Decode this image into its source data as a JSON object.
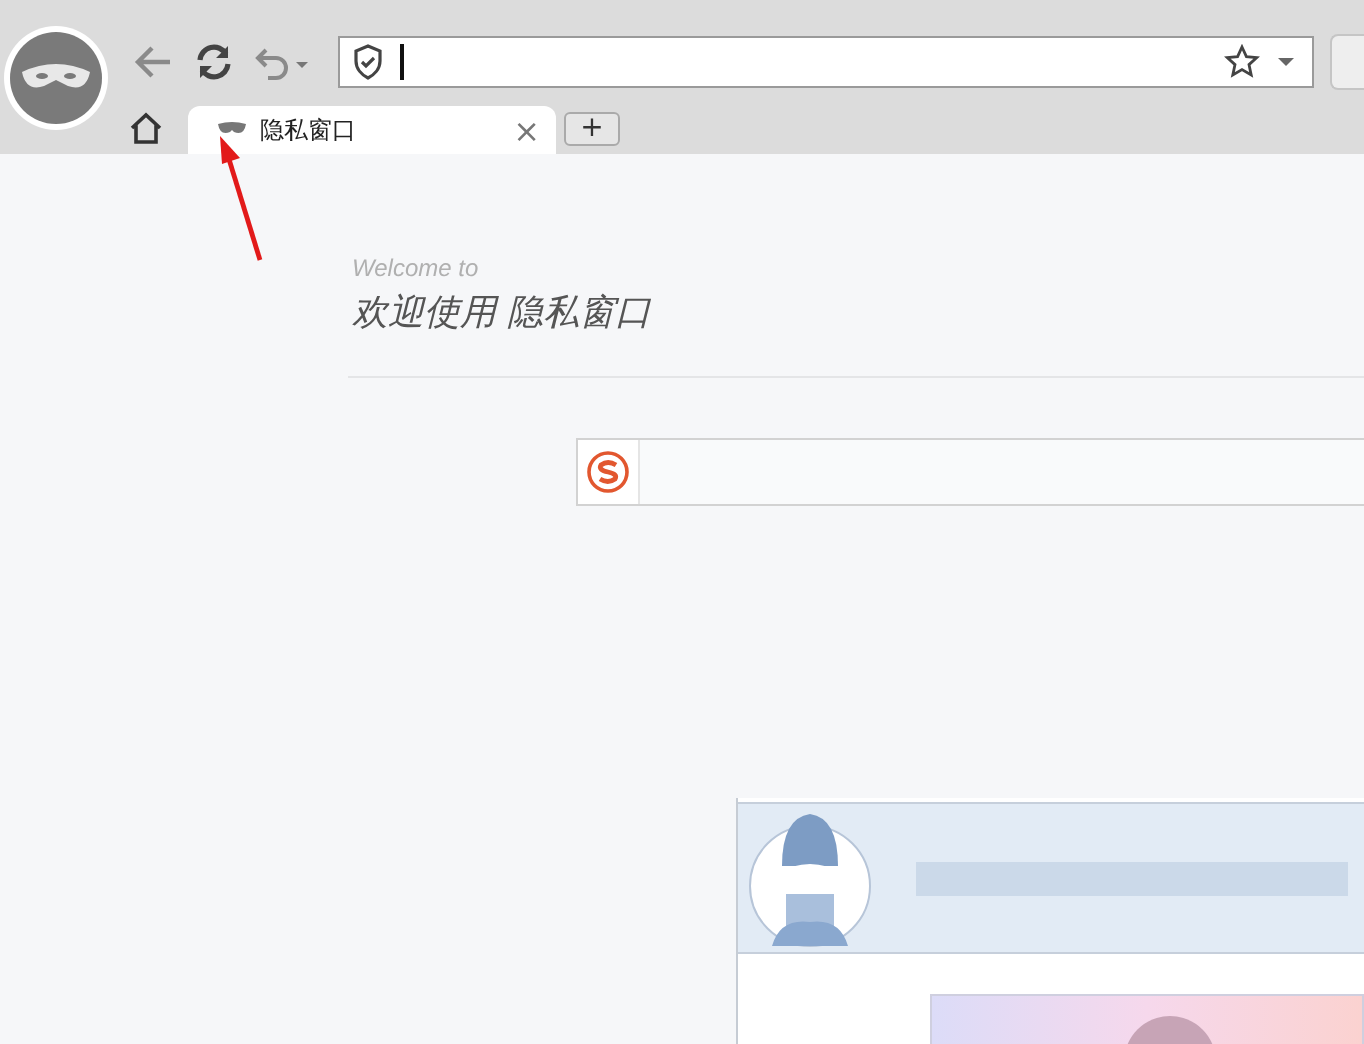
{
  "tabs": [
    {
      "label": "隐私窗口",
      "close": "×",
      "selected": true
    },
    {
      "label": "+",
      "selected": false
    }
  ],
  "welcome": {
    "subtitle": "Welcome to",
    "title": "欢迎使用 隐私窗口"
  }
}
